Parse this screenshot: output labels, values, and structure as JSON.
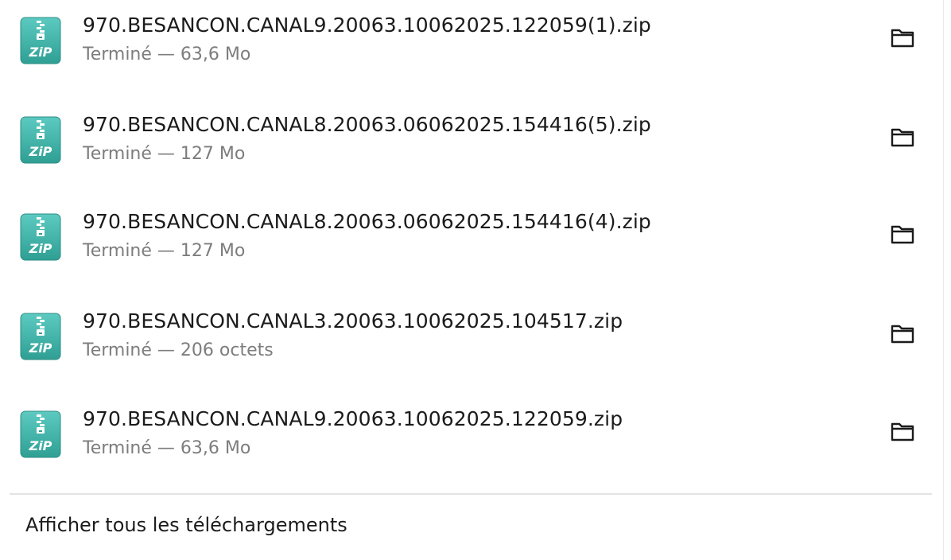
{
  "downloads": {
    "items": [
      {
        "filename": "970.BESANCON.CANAL9.20063.10062025.122059(1).zip",
        "status": "Terminé — 63,6 Mo",
        "icon": "zip-file-icon"
      },
      {
        "filename": "970.BESANCON.CANAL8.20063.06062025.154416(5).zip",
        "status": "Terminé — 127 Mo",
        "icon": "zip-file-icon"
      },
      {
        "filename": "970.BESANCON.CANAL8.20063.06062025.154416(4).zip",
        "status": "Terminé — 127 Mo",
        "icon": "zip-file-icon"
      },
      {
        "filename": "970.BESANCON.CANAL3.20063.10062025.104517.zip",
        "status": "Terminé — 206 octets",
        "icon": "zip-file-icon"
      },
      {
        "filename": "970.BESANCON.CANAL9.20063.10062025.122059.zip",
        "status": "Terminé — 63,6 Mo",
        "icon": "zip-file-icon"
      }
    ],
    "folder_icon": "folder-icon",
    "show_all_label": "Afficher tous les téléchargements"
  },
  "colors": {
    "zip_icon_top": "#4fc2b8",
    "zip_icon_bottom": "#2e9e93",
    "text_primary": "#1b1b1b",
    "text_secondary": "#7d7d7d",
    "separator": "#e3e3e3"
  }
}
